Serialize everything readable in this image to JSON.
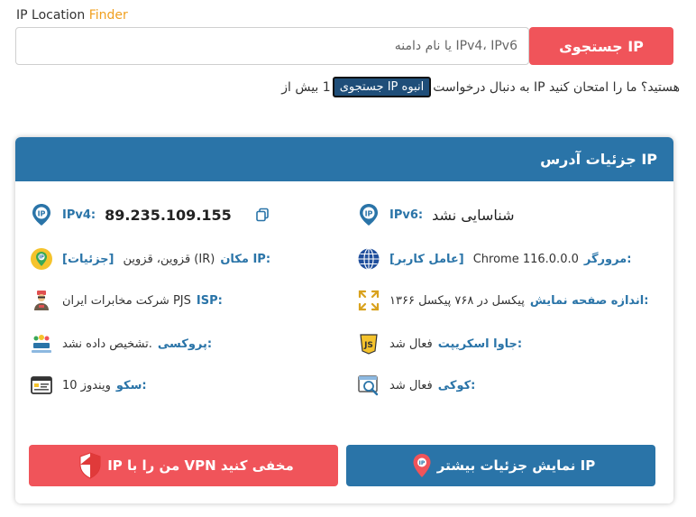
{
  "header": {
    "title_main": "IP Location",
    "title_accent": "Finder",
    "accent_color": "#f0a020"
  },
  "search": {
    "placeholder": "IPv4، IPv6 یا نام دامنه",
    "button_label": "IP جستجوی"
  },
  "bulk": {
    "lead_text": "1 بیش از",
    "button_label": "انبوه IP جستجوی",
    "tail_text": "هستید؟ ما را امتحان کنید IP به دنبال درخواست"
  },
  "card": {
    "title": "IP جزئیات آدرس",
    "header_color": "#2a74a8"
  },
  "left": {
    "ipv4_label": "IPv4:",
    "ipv4_value": "89.235.109.155",
    "location_label": ":IP مکان",
    "location_value": "(IR) قزوین، قزوین",
    "details_link": "[جزئیات]",
    "isp_label": ":ISP",
    "isp_value": "PJS شرکت مخابرات ایران",
    "proxy_label": ":پروکسی",
    "proxy_value": ".تشخیص داده نشد",
    "os_label": ":سکو",
    "os_value": "ویندوز 10"
  },
  "right": {
    "ipv6_label": "IPv6:",
    "ipv6_value": "شناسایی نشد",
    "browser_label": ":مرورگر",
    "browser_value": "Chrome 116.0.0.0",
    "useragent_link": "[عامل کاربر]",
    "screen_label": ":اندازه صفحه نمایش",
    "screen_value": "پیکسل در ۷۶۸ پیکسل ۱۳۶۶",
    "js_label": ":جاوا اسکریپت",
    "js_value": "فعال شد",
    "cookie_label": ":کوکی",
    "cookie_value": "فعال شد"
  },
  "buttons": {
    "vpn_label": "مخفی کنید VPN من را با IP",
    "more_label": "IP نمایش جزئیات بیشتر",
    "vpn_color": "#f0545a",
    "more_color": "#2a74a8"
  }
}
